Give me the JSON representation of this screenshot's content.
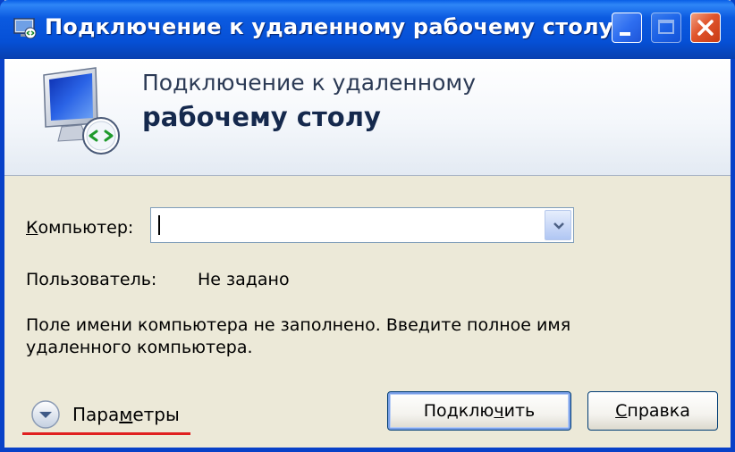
{
  "window": {
    "title": "Подключение к удаленному рабочему столу"
  },
  "banner": {
    "line1": "Подключение к удаленному",
    "line2": "рабочему столу"
  },
  "form": {
    "computer_label_accel": "К",
    "computer_label_rest": "омпьютер:",
    "computer_value": "",
    "user_label": "Пользователь:",
    "user_value": "Не задано",
    "message": "Поле имени компьютера не заполнено. Введите полное имя удаленного компьютера."
  },
  "options": {
    "label_pre": "Пара",
    "label_accel": "м",
    "label_post": "етры"
  },
  "buttons": {
    "connect_pre": "Подклю",
    "connect_accel": "ч",
    "connect_post": "ить",
    "help_accel": "С",
    "help_post": "правка"
  },
  "colors": {
    "titlebar": "#0650d6",
    "accent_underline": "#e02020"
  },
  "icons": {
    "title": "remote-desktop-icon",
    "banner": "remote-desktop-monitor-icon",
    "options": "chevron-down-circle-icon"
  }
}
